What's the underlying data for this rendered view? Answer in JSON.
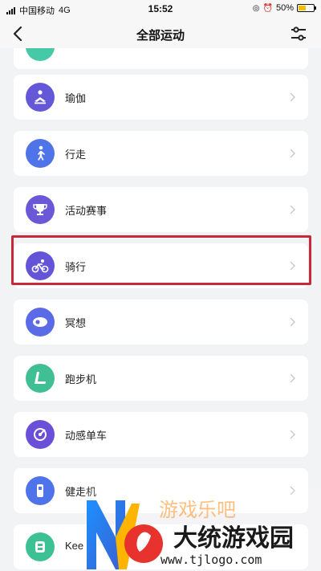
{
  "status_bar": {
    "carrier": "中国移动",
    "network": "4G",
    "time": "15:52",
    "battery": "50%",
    "battery_level": 0.5
  },
  "header": {
    "title": "全部运动",
    "back_icon": "chevron-left-icon",
    "filter_icon": "sliders-icon"
  },
  "activities": [
    {
      "label": "",
      "icon": "partial-icon",
      "color": "#45c9a6"
    },
    {
      "label": "瑜伽",
      "icon": "yoga-icon",
      "color": "#6558d8"
    },
    {
      "label": "行走",
      "icon": "walking-icon",
      "color": "#4f73e8"
    },
    {
      "label": "活动赛事",
      "icon": "trophy-icon",
      "color": "#6a58d6"
    },
    {
      "label": "骑行",
      "icon": "cycling-icon",
      "color": "#6454d8"
    },
    {
      "label": "冥想",
      "icon": "meditation-icon",
      "color": "#5b6ae6"
    },
    {
      "label": "跑步机",
      "icon": "treadmill-icon",
      "color": "#3fbf93"
    },
    {
      "label": "动感单车",
      "icon": "spinning-icon",
      "color": "#6a50d8"
    },
    {
      "label": "健走机",
      "icon": "walking-machine-icon",
      "color": "#4f73e8"
    },
    {
      "label": "Kee",
      "icon": "keep-icon",
      "color": "#3cc195"
    }
  ],
  "highlight_color": "#c8283a",
  "watermark": {
    "text": "大统游戏园",
    "url": "www.tjlogo.com",
    "partial": "游戏乐吧"
  }
}
